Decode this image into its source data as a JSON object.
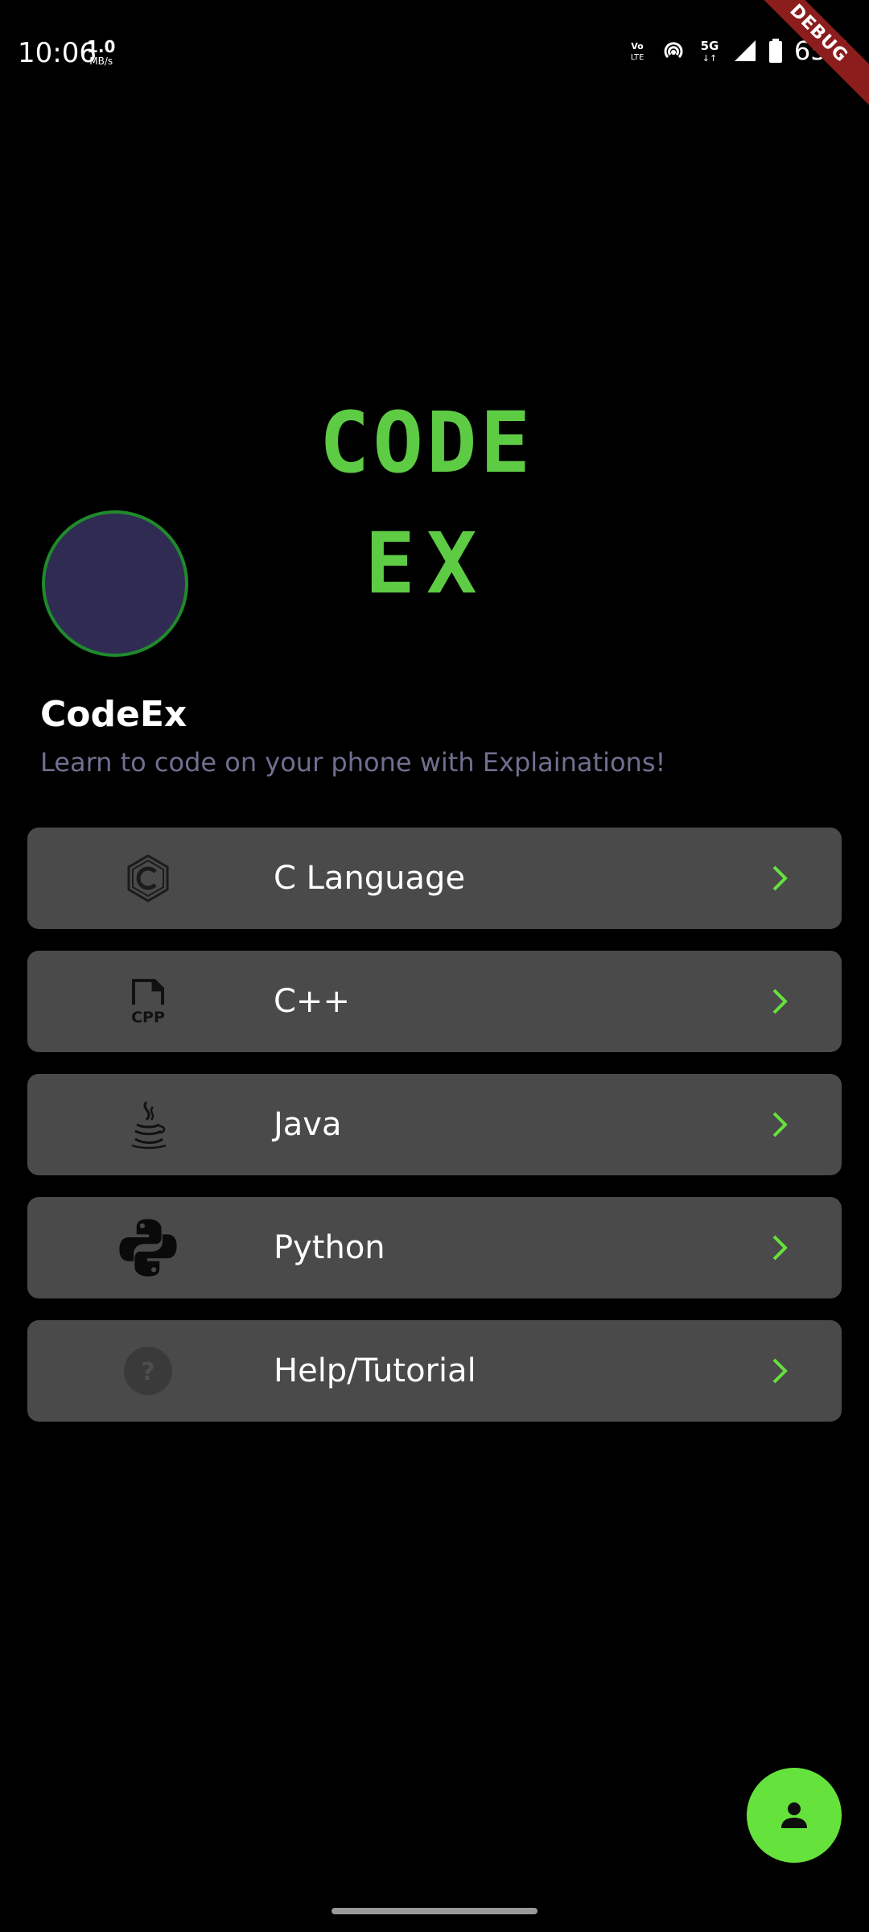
{
  "status_bar": {
    "time": "10:06",
    "net_speed_value": "1.0",
    "net_speed_unit": "MB/s",
    "volte": "Vo LTE",
    "network": "5G",
    "battery": "65%"
  },
  "debug_banner": "DEBUG",
  "header": {
    "logo_line1": "CODE",
    "logo_line2": "EX",
    "title": "CodeEx",
    "subtitle": "Learn to code on your phone with Explainations!"
  },
  "courses": [
    {
      "label": "C Language",
      "icon": "c-language-icon"
    },
    {
      "label": "C++",
      "icon": "cpp-file-icon"
    },
    {
      "label": "Java",
      "icon": "java-icon"
    },
    {
      "label": "Python",
      "icon": "python-icon"
    },
    {
      "label": "Help/Tutorial",
      "icon": "help-icon"
    }
  ],
  "colors": {
    "accent": "#66e23d",
    "logo_green": "#5ecb45",
    "card_bg": "#4a4a4a",
    "subtitle": "#6f7090",
    "avatar_fill": "#2f2b52",
    "avatar_border": "#1f8a2c"
  },
  "fab": {
    "icon": "person-icon"
  }
}
